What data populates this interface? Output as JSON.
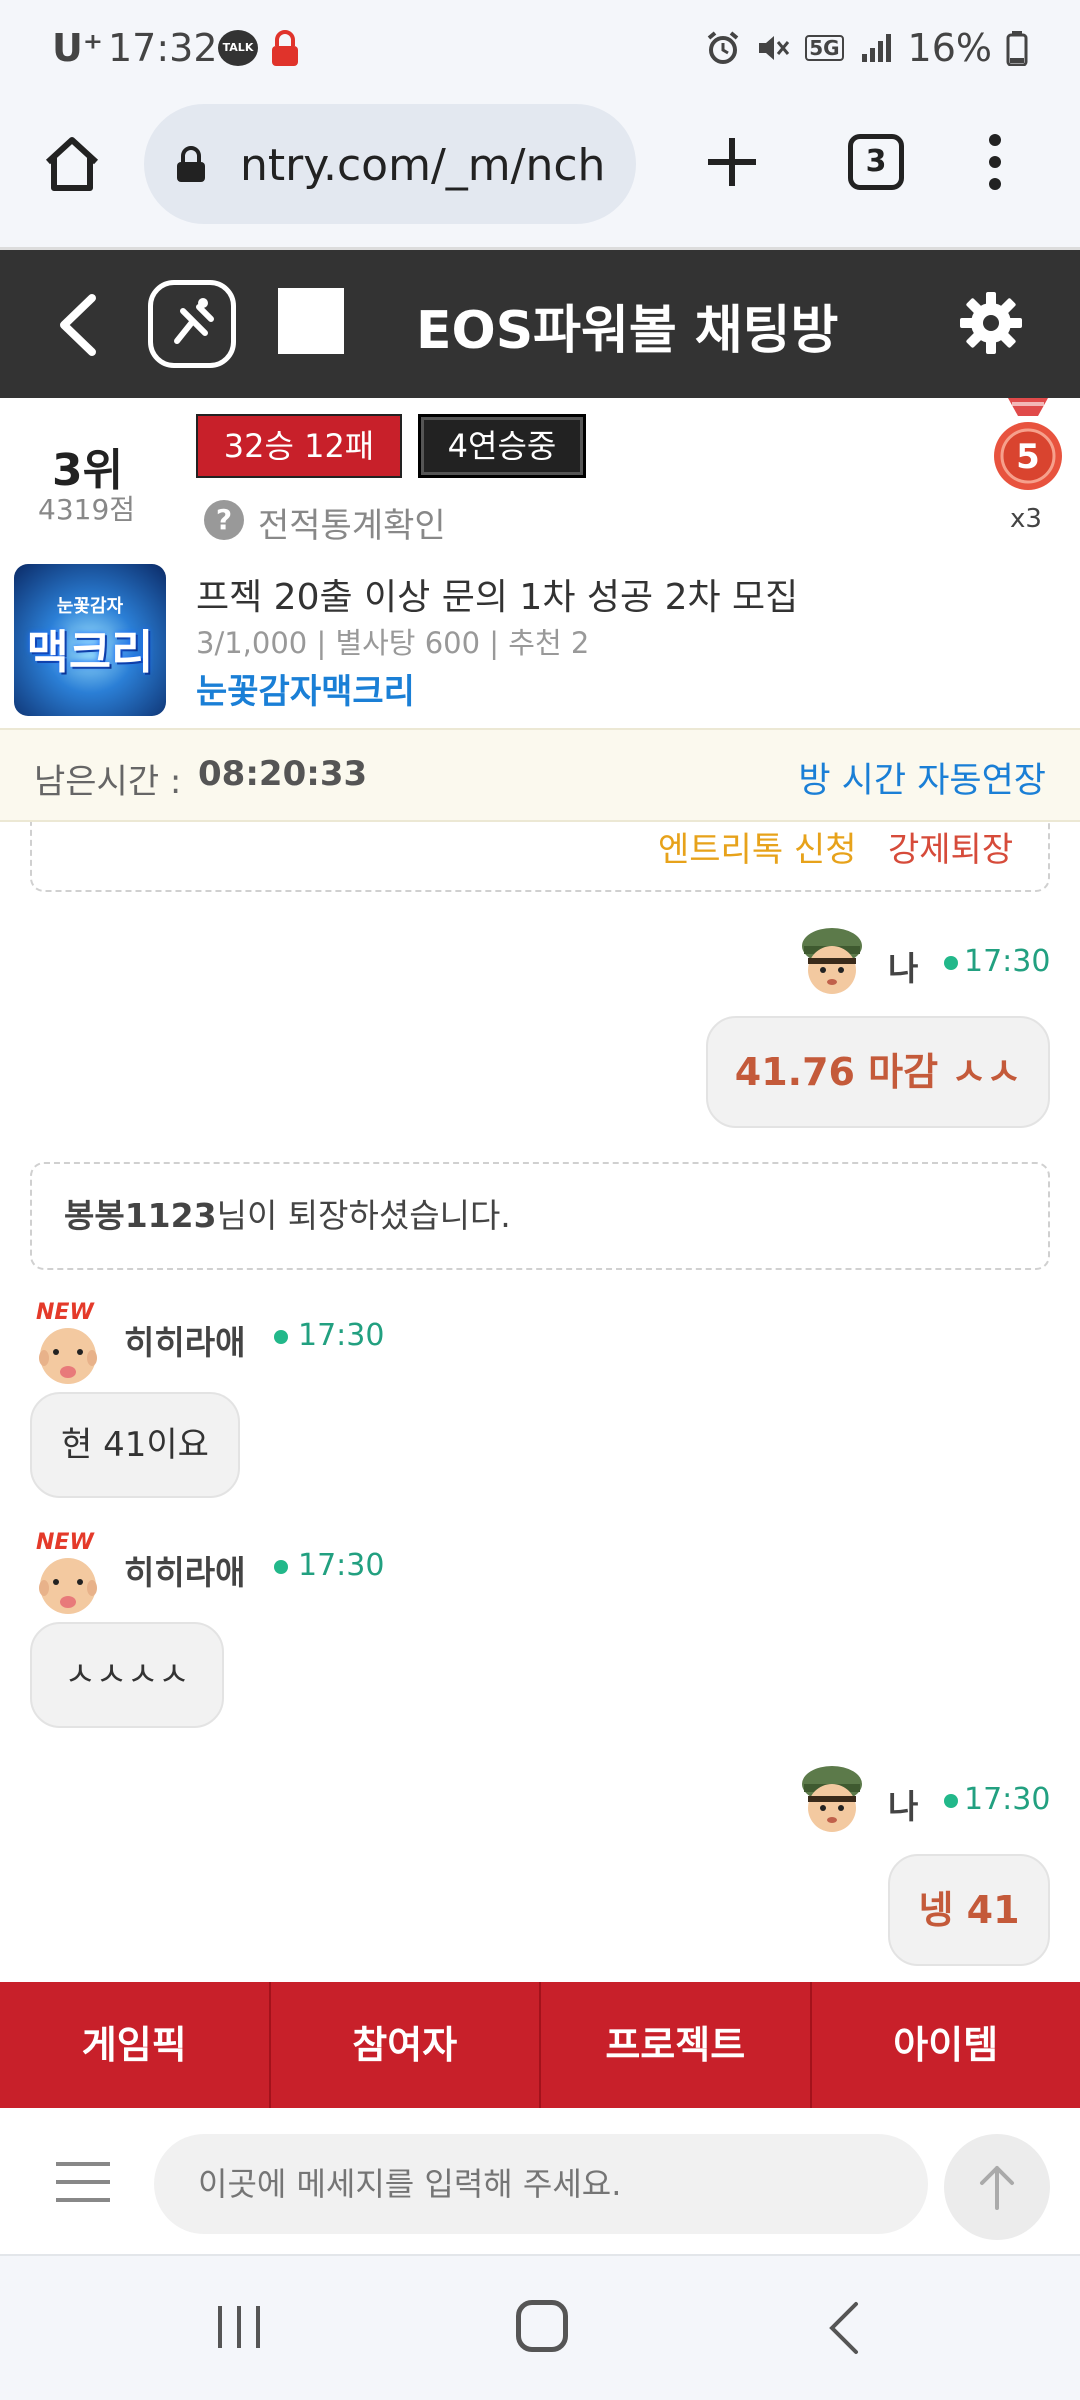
{
  "status_bar": {
    "carrier": "U⁺",
    "time": "17:32",
    "talk_label": "TALK",
    "network": "5G",
    "battery": "16%"
  },
  "browser": {
    "url": "ntry.com/_m/nch",
    "tab_count": "3"
  },
  "header": {
    "title": "EOS파워볼 채팅방"
  },
  "profile": {
    "rank": "3위",
    "points": "4319점",
    "record": "32승 12패",
    "streak": "4연승중",
    "stats_link": "전적통계확인",
    "medal_level": "5",
    "medal_count": "x3"
  },
  "room": {
    "thumb_small": "눈꽃감자",
    "thumb_big": "맥크리",
    "title": "프젝 20출 이상 문의 1차 성공 2차 모집",
    "meta": "3/1,000 | 별사탕 600 | 추천 2",
    "owner": "눈꽃감자맥크리"
  },
  "timer": {
    "label": "남은시간 :",
    "value": "08:20:33",
    "extend_link": "방 시간 자동연장"
  },
  "system_top": {
    "entry_request": "엔트리톡 신청",
    "force_kick": "강제퇴장"
  },
  "messages": [
    {
      "nick": "나",
      "time": "17:30",
      "text": "41.76 마감 ㅅㅅ"
    },
    {
      "system_user": "봉봉1123",
      "system_text": "님이 퇴장하셨습니다."
    },
    {
      "nick": "히히라애",
      "time": "17:30",
      "text": "현 41이요",
      "tag": "NEW"
    },
    {
      "nick": "히히라애",
      "time": "17:30",
      "text": "ㅅㅅㅅㅅ",
      "tag": "NEW"
    },
    {
      "nick": "나",
      "time": "17:30",
      "text": "넹 41"
    }
  ],
  "tabs": [
    "게임픽",
    "참여자",
    "프로젝트",
    "아이템"
  ],
  "input": {
    "placeholder": "이곳에 메세지를 입력해 주세요."
  },
  "colors": {
    "header_bg": "#333333",
    "tab_bg": "#c8202a",
    "link_blue": "#1a7fd6",
    "online_green": "#22b88a",
    "my_message": "#c45a3a"
  }
}
